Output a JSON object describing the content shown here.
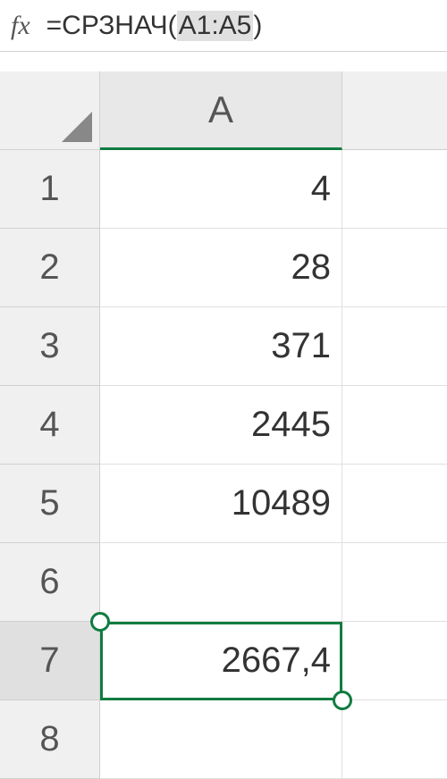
{
  "formula_bar": {
    "fx_label": "fx",
    "formula_prefix": "=СРЗНАЧ( ",
    "formula_range": "A1:A5",
    "formula_suffix": " )"
  },
  "column_header": "A",
  "rows": [
    {
      "num": "1",
      "value": "4"
    },
    {
      "num": "2",
      "value": "28"
    },
    {
      "num": "3",
      "value": "371"
    },
    {
      "num": "4",
      "value": "2445"
    },
    {
      "num": "5",
      "value": "10489"
    },
    {
      "num": "6",
      "value": ""
    },
    {
      "num": "7",
      "value": "2667,4"
    },
    {
      "num": "8",
      "value": ""
    }
  ],
  "selected_row_index": 6
}
